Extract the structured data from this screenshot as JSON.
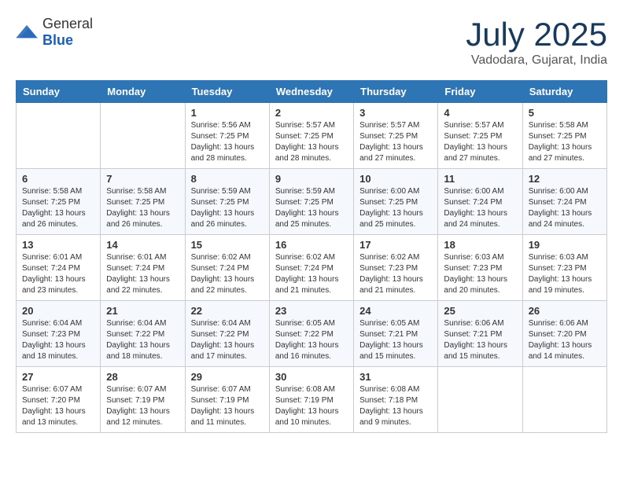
{
  "header": {
    "logo_general": "General",
    "logo_blue": "Blue",
    "month_title": "July 2025",
    "location": "Vadodara, Gujarat, India"
  },
  "weekdays": [
    "Sunday",
    "Monday",
    "Tuesday",
    "Wednesday",
    "Thursday",
    "Friday",
    "Saturday"
  ],
  "weeks": [
    [
      {
        "day": "",
        "info": ""
      },
      {
        "day": "",
        "info": ""
      },
      {
        "day": "1",
        "info": "Sunrise: 5:56 AM\nSunset: 7:25 PM\nDaylight: 13 hours\nand 28 minutes."
      },
      {
        "day": "2",
        "info": "Sunrise: 5:57 AM\nSunset: 7:25 PM\nDaylight: 13 hours\nand 28 minutes."
      },
      {
        "day": "3",
        "info": "Sunrise: 5:57 AM\nSunset: 7:25 PM\nDaylight: 13 hours\nand 27 minutes."
      },
      {
        "day": "4",
        "info": "Sunrise: 5:57 AM\nSunset: 7:25 PM\nDaylight: 13 hours\nand 27 minutes."
      },
      {
        "day": "5",
        "info": "Sunrise: 5:58 AM\nSunset: 7:25 PM\nDaylight: 13 hours\nand 27 minutes."
      }
    ],
    [
      {
        "day": "6",
        "info": "Sunrise: 5:58 AM\nSunset: 7:25 PM\nDaylight: 13 hours\nand 26 minutes."
      },
      {
        "day": "7",
        "info": "Sunrise: 5:58 AM\nSunset: 7:25 PM\nDaylight: 13 hours\nand 26 minutes."
      },
      {
        "day": "8",
        "info": "Sunrise: 5:59 AM\nSunset: 7:25 PM\nDaylight: 13 hours\nand 26 minutes."
      },
      {
        "day": "9",
        "info": "Sunrise: 5:59 AM\nSunset: 7:25 PM\nDaylight: 13 hours\nand 25 minutes."
      },
      {
        "day": "10",
        "info": "Sunrise: 6:00 AM\nSunset: 7:25 PM\nDaylight: 13 hours\nand 25 minutes."
      },
      {
        "day": "11",
        "info": "Sunrise: 6:00 AM\nSunset: 7:24 PM\nDaylight: 13 hours\nand 24 minutes."
      },
      {
        "day": "12",
        "info": "Sunrise: 6:00 AM\nSunset: 7:24 PM\nDaylight: 13 hours\nand 24 minutes."
      }
    ],
    [
      {
        "day": "13",
        "info": "Sunrise: 6:01 AM\nSunset: 7:24 PM\nDaylight: 13 hours\nand 23 minutes."
      },
      {
        "day": "14",
        "info": "Sunrise: 6:01 AM\nSunset: 7:24 PM\nDaylight: 13 hours\nand 22 minutes."
      },
      {
        "day": "15",
        "info": "Sunrise: 6:02 AM\nSunset: 7:24 PM\nDaylight: 13 hours\nand 22 minutes."
      },
      {
        "day": "16",
        "info": "Sunrise: 6:02 AM\nSunset: 7:24 PM\nDaylight: 13 hours\nand 21 minutes."
      },
      {
        "day": "17",
        "info": "Sunrise: 6:02 AM\nSunset: 7:23 PM\nDaylight: 13 hours\nand 21 minutes."
      },
      {
        "day": "18",
        "info": "Sunrise: 6:03 AM\nSunset: 7:23 PM\nDaylight: 13 hours\nand 20 minutes."
      },
      {
        "day": "19",
        "info": "Sunrise: 6:03 AM\nSunset: 7:23 PM\nDaylight: 13 hours\nand 19 minutes."
      }
    ],
    [
      {
        "day": "20",
        "info": "Sunrise: 6:04 AM\nSunset: 7:23 PM\nDaylight: 13 hours\nand 18 minutes."
      },
      {
        "day": "21",
        "info": "Sunrise: 6:04 AM\nSunset: 7:22 PM\nDaylight: 13 hours\nand 18 minutes."
      },
      {
        "day": "22",
        "info": "Sunrise: 6:04 AM\nSunset: 7:22 PM\nDaylight: 13 hours\nand 17 minutes."
      },
      {
        "day": "23",
        "info": "Sunrise: 6:05 AM\nSunset: 7:22 PM\nDaylight: 13 hours\nand 16 minutes."
      },
      {
        "day": "24",
        "info": "Sunrise: 6:05 AM\nSunset: 7:21 PM\nDaylight: 13 hours\nand 15 minutes."
      },
      {
        "day": "25",
        "info": "Sunrise: 6:06 AM\nSunset: 7:21 PM\nDaylight: 13 hours\nand 15 minutes."
      },
      {
        "day": "26",
        "info": "Sunrise: 6:06 AM\nSunset: 7:20 PM\nDaylight: 13 hours\nand 14 minutes."
      }
    ],
    [
      {
        "day": "27",
        "info": "Sunrise: 6:07 AM\nSunset: 7:20 PM\nDaylight: 13 hours\nand 13 minutes."
      },
      {
        "day": "28",
        "info": "Sunrise: 6:07 AM\nSunset: 7:19 PM\nDaylight: 13 hours\nand 12 minutes."
      },
      {
        "day": "29",
        "info": "Sunrise: 6:07 AM\nSunset: 7:19 PM\nDaylight: 13 hours\nand 11 minutes."
      },
      {
        "day": "30",
        "info": "Sunrise: 6:08 AM\nSunset: 7:19 PM\nDaylight: 13 hours\nand 10 minutes."
      },
      {
        "day": "31",
        "info": "Sunrise: 6:08 AM\nSunset: 7:18 PM\nDaylight: 13 hours\nand 9 minutes."
      },
      {
        "day": "",
        "info": ""
      },
      {
        "day": "",
        "info": ""
      }
    ]
  ]
}
